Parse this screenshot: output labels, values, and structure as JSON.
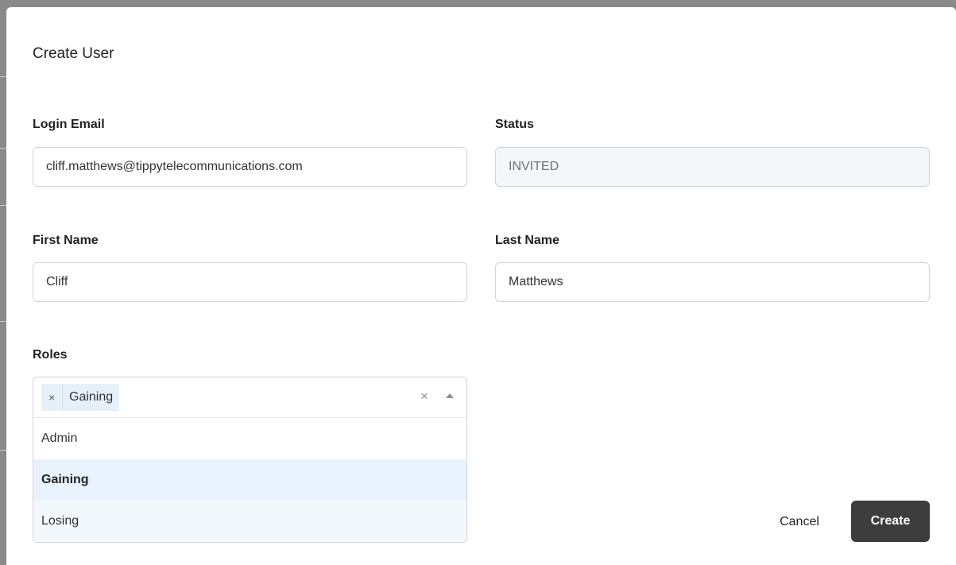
{
  "dialog": {
    "title": "Create User"
  },
  "form": {
    "login_email": {
      "label": "Login Email",
      "value": "cliff.matthews@tippytelecommunications.com"
    },
    "status": {
      "label": "Status",
      "value": "INVITED"
    },
    "first_name": {
      "label": "First Name",
      "value": "Cliff"
    },
    "last_name": {
      "label": "Last Name",
      "value": "Matthews"
    },
    "roles": {
      "label": "Roles",
      "selected_chip": {
        "remove_symbol": "×",
        "label": "Gaining"
      },
      "clear_symbol": "×",
      "options": [
        {
          "label": "Admin",
          "state": "normal"
        },
        {
          "label": "Gaining",
          "state": "selected"
        },
        {
          "label": "Losing",
          "state": "hover"
        }
      ]
    }
  },
  "actions": {
    "cancel_label": "Cancel",
    "create_label": "Create"
  },
  "colors": {
    "primary_button": "#3d3d3d",
    "chip_background": "#e6f0fa",
    "selected_option": "#e8f3fd",
    "disabled_input": "#f4f6f9"
  }
}
